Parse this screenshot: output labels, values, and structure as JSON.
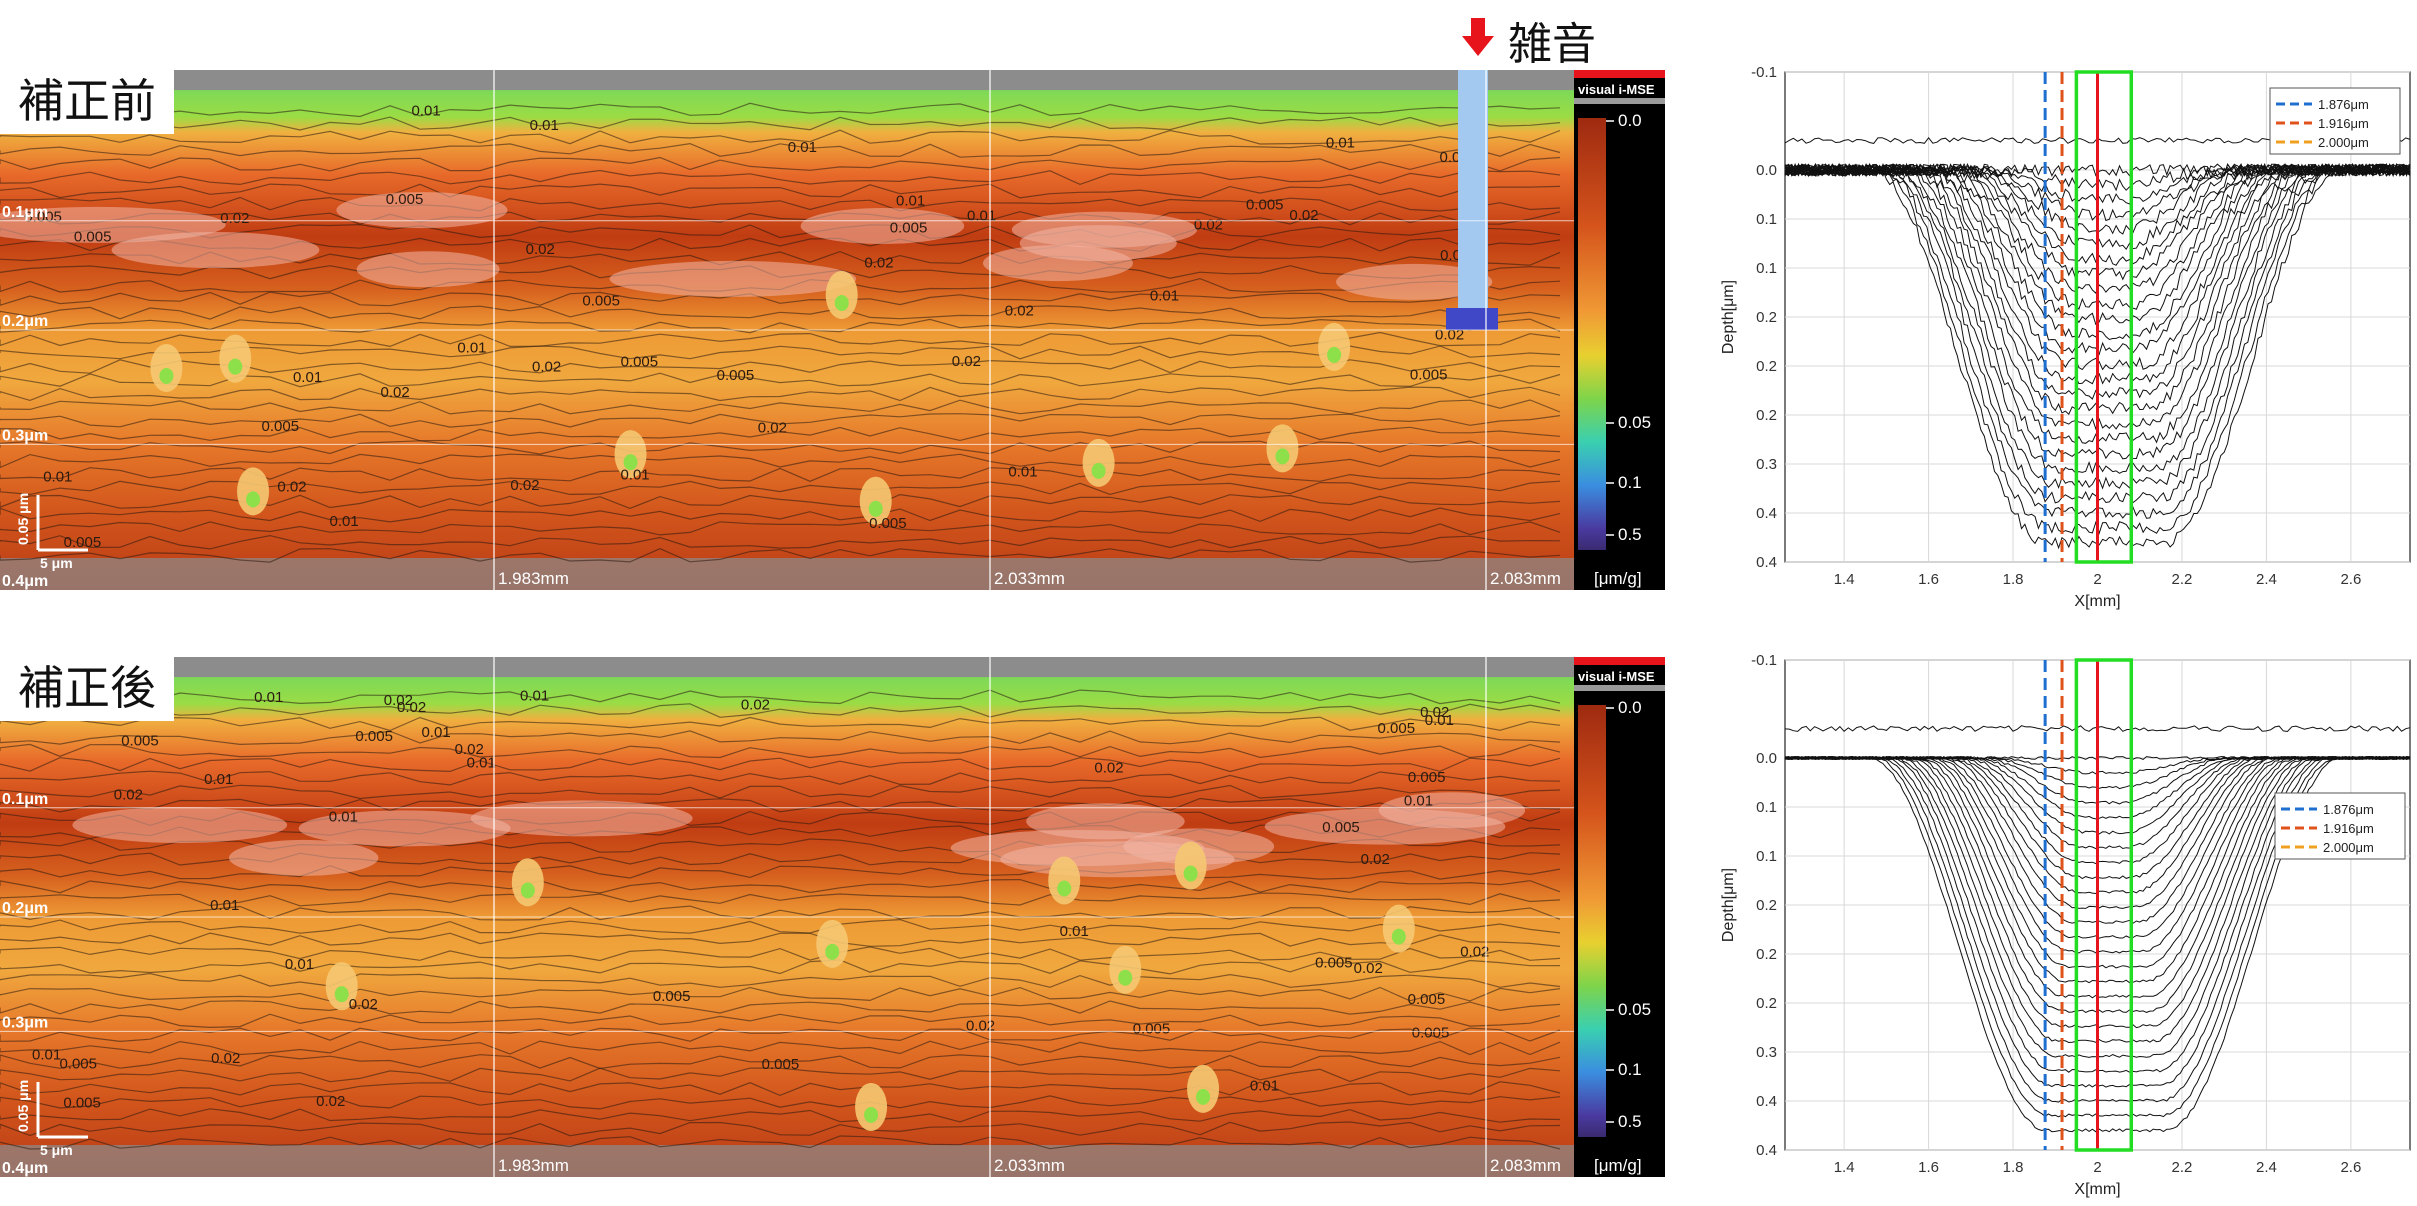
{
  "annotation": {
    "noise_label": "雑音",
    "arrow": "down-arrow-icon",
    "arrow_color": "#e8141c"
  },
  "panels": [
    {
      "label": "補正前",
      "brand": "visual i-MSE",
      "depth_ticks": [
        "0.1μm",
        "0.2μm",
        "0.3μm",
        "0.4μm"
      ],
      "x_ticks": [
        "1.983mm",
        "2.033mm",
        "2.083mm"
      ],
      "scale_v": "0.05 μm",
      "scale_h": "5 μm",
      "colorbar": {
        "ticks": [
          "0.0",
          "0.05",
          "0.1",
          "0.5"
        ],
        "unit": "[μm/g]"
      },
      "contour_labels": [
        "0.02",
        "0.01",
        "0.005"
      ]
    },
    {
      "label": "補正後",
      "brand": "visual i-MSE",
      "depth_ticks": [
        "0.1μm",
        "0.2μm",
        "0.3μm",
        "0.4μm"
      ],
      "x_ticks": [
        "1.983mm",
        "2.033mm",
        "2.083mm"
      ],
      "scale_v": "0.05 μm",
      "scale_h": "5 μm",
      "colorbar": {
        "ticks": [
          "0.0",
          "0.05",
          "0.1",
          "0.5"
        ],
        "unit": "[μm/g]"
      },
      "contour_labels": [
        "0.02",
        "0.01",
        "0.005"
      ]
    }
  ],
  "chart_data": [
    {
      "type": "line",
      "xlabel": "X[mm]",
      "ylabel": "Depth[μm]",
      "xlim": [
        1.26,
        2.74
      ],
      "ylim": [
        -0.1,
        0.4
      ],
      "x_ticks": [
        "1.4",
        "1.6",
        "1.8",
        "2",
        "2.2",
        "2.4",
        "2.6"
      ],
      "y_ticks": [
        "-0.1",
        "0.0",
        "0.1",
        "0.1",
        "0.2",
        "0.2",
        "0.2",
        "0.3",
        "0.4",
        "0.4"
      ],
      "legend": [
        {
          "name": "1.876μm",
          "x": 1.876,
          "color": "#1f6fd0"
        },
        {
          "name": "1.916μm",
          "x": 1.916,
          "color": "#e0521c"
        },
        {
          "name": "2.000μm",
          "x": 2.0,
          "color": "#f0a020"
        }
      ],
      "legend_position": "top-right",
      "red_line_x": 2.0,
      "green_box_x": [
        1.95,
        2.08
      ],
      "profile_count": 26,
      "max_depth": 0.38,
      "bottom_x_range": [
        1.9,
        2.15
      ],
      "surface_x_range": [
        1.35,
        2.6
      ],
      "noisy": true,
      "grid": true
    },
    {
      "type": "line",
      "xlabel": "X[mm]",
      "ylabel": "Depth[μm]",
      "xlim": [
        1.26,
        2.74
      ],
      "ylim": [
        -0.1,
        0.4
      ],
      "x_ticks": [
        "1.4",
        "1.6",
        "1.8",
        "2",
        "2.2",
        "2.4",
        "2.6"
      ],
      "y_ticks": [
        "-0.1",
        "0.0",
        "0.1",
        "0.1",
        "0.2",
        "0.2",
        "0.2",
        "0.3",
        "0.4",
        "0.4"
      ],
      "legend": [
        {
          "name": "1.876μm",
          "x": 1.876,
          "color": "#1f6fd0"
        },
        {
          "name": "1.916μm",
          "x": 1.916,
          "color": "#e0521c"
        },
        {
          "name": "2.000μm",
          "x": 2.0,
          "color": "#f0a020"
        }
      ],
      "legend_position": "right",
      "red_line_x": 2.0,
      "green_box_x": [
        1.95,
        2.08
      ],
      "profile_count": 26,
      "max_depth": 0.38,
      "bottom_x_range": [
        1.9,
        2.15
      ],
      "surface_x_range": [
        1.35,
        2.6
      ],
      "noisy": false,
      "grid": true
    }
  ]
}
